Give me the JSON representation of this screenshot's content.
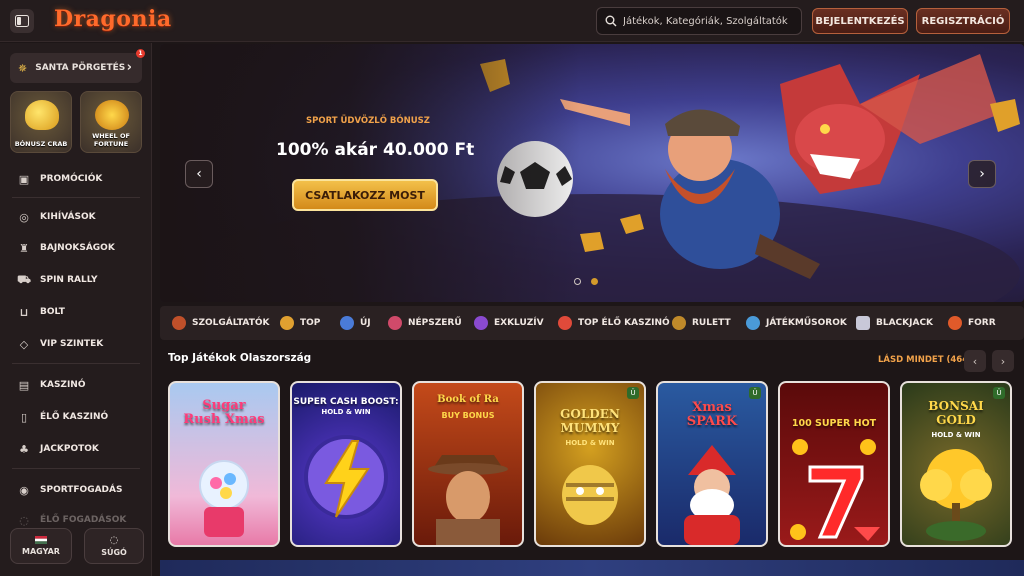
{
  "header": {
    "logo": "Dragonia",
    "search_placeholder": "Játékok, Kategóriák, Szolgáltatók",
    "login_label": "BEJELENTKEZÉS",
    "register_label": "REGISZTRÁCIÓ"
  },
  "sidebar": {
    "santa_label": "SANTA PÖRGETÉS",
    "santa_badge": "1",
    "tiles": [
      {
        "label_1": "BÓNUSZ CRAB",
        "label_2": ""
      },
      {
        "label_1": "WHEEL OF",
        "label_2": "FORTUNE"
      }
    ],
    "items": [
      {
        "label": "PROMÓCIÓK",
        "icon": "gift-icon"
      },
      {
        "label": "KIHÍVÁSOK",
        "icon": "medal-icon"
      },
      {
        "label": "BAJNOKSÁGOK",
        "icon": "trophy-icon"
      },
      {
        "label": "SPIN RALLY",
        "icon": "car-icon"
      },
      {
        "label": "BOLT",
        "icon": "basket-icon"
      },
      {
        "label": "VIP SZINTEK",
        "icon": "diamond-icon"
      },
      {
        "label": "KASZINÓ",
        "icon": "slot-icon"
      },
      {
        "label": "ÉLŐ KASZINÓ",
        "icon": "cards-icon"
      },
      {
        "label": "JACKPOTOK",
        "icon": "clover-icon"
      },
      {
        "label": "SPORTFOGADÁS",
        "icon": "ball-icon"
      },
      {
        "label": "ÉLŐ FOGADÁSOK",
        "icon": "live-icon"
      }
    ],
    "language_label": "MAGYAR",
    "help_label": "SÚGÓ"
  },
  "banner": {
    "subtitle": "SPORT ÜDVÖZLŐ BÓNUSZ",
    "title": "100% akár 40.000 Ft",
    "cta": "CSATLAKOZZ MOST"
  },
  "categories": [
    {
      "label": "SZOLGÁLTATÓK",
      "color": "#c0502a"
    },
    {
      "label": "TOP",
      "color": "#e0a030"
    },
    {
      "label": "ÚJ",
      "color": "#4a7bd8"
    },
    {
      "label": "NÉPSZERŰ",
      "color": "#d04a6a"
    },
    {
      "label": "EXKLUZÍV",
      "color": "#8a4ad0"
    },
    {
      "label": "TOP ÉLŐ KASZINÓ",
      "color": "#e04a3a"
    },
    {
      "label": "RULETT",
      "color": "#c08a2a"
    },
    {
      "label": "JÁTÉKMŰSOROK",
      "color": "#4a9ad8"
    },
    {
      "label": "BLACKJACK",
      "color": "#c8c8d8"
    },
    {
      "label": "FORR",
      "color": "#e05a2a"
    }
  ],
  "games_section": {
    "title": "Top Játékok Olaszország",
    "see_all": "LÁSD MINDET (464)"
  },
  "games": [
    {
      "title": "Sugar Rush Xmas",
      "sub": ""
    },
    {
      "title": "SUPER CASH BOOST:",
      "sub": "HOLD & WIN"
    },
    {
      "title": "Book of Ra",
      "sub": "BUY BONUS"
    },
    {
      "title": "GOLDEN MUMMY",
      "sub": "HOLD & WIN"
    },
    {
      "title": "Xmas SPARK",
      "sub": ""
    },
    {
      "title": "100 SUPER HOT",
      "sub": ""
    },
    {
      "title": "BONSAI GOLD",
      "sub": "HOLD & WIN"
    }
  ]
}
